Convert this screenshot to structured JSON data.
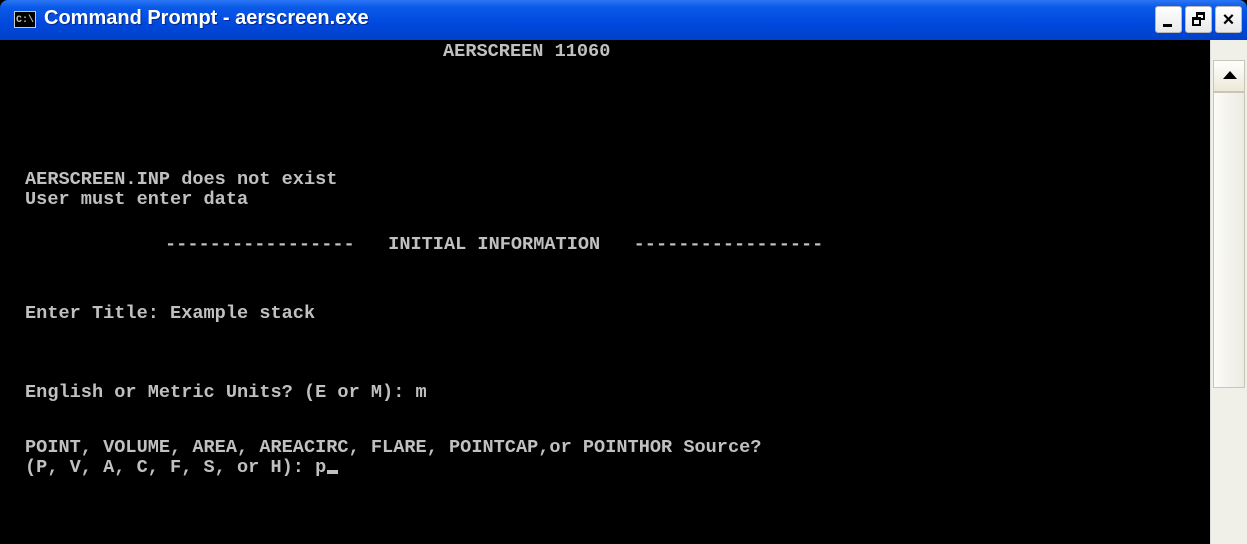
{
  "window": {
    "title": "Command Prompt - aerscreen.exe",
    "icon_label": "C:\\",
    "icon": "console-icon",
    "buttons": {
      "minimize": "minimize-icon",
      "maximize": "restore-icon",
      "close": "×"
    }
  },
  "console": {
    "lines": [
      "AERSCREEN 11060",
      "AERSCREEN.INP does not exist",
      "User must enter data",
      "-----------------   INITIAL INFORMATION   -----------------",
      "Enter Title: Example stack",
      "English or Metric Units? (E or M): m",
      "POINT, VOLUME, AREA, AREACIRC, FLARE, POINTCAP,or POINTHOR Source?",
      "(P, V, A, C, F, S, or H): p"
    ]
  },
  "colors": {
    "titlebar": "#0048dd",
    "console_bg": "#000000",
    "console_text": "#c0c0c0"
  }
}
